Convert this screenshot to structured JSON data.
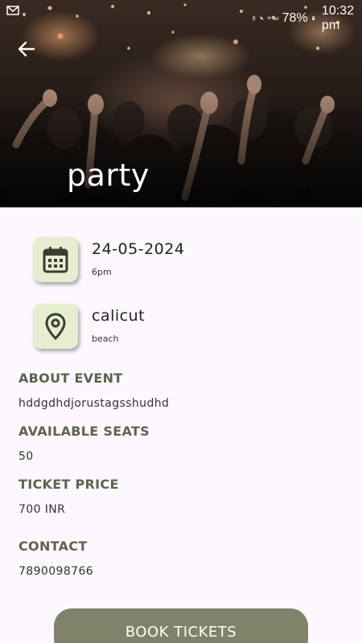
{
  "status_bar": {
    "battery_percent": "78%",
    "time": "10:32 pm"
  },
  "event": {
    "title": "party",
    "date": "24-05-2024",
    "time": "6pm",
    "location": "calicut",
    "venue": "beach"
  },
  "sections": {
    "about_heading": "ABOUT EVENT",
    "about_value": "hddgdhdjorustagsshudhd",
    "seats_heading": "AVAILABLE SEATS",
    "seats_value": "50",
    "price_heading": "TICKET PRICE",
    "price_value": "700 INR",
    "contact_heading": "CONTACT",
    "contact_value": "7890098766"
  },
  "book_button_label": "BOOK TICKETS",
  "colors": {
    "accent": "#7f836a",
    "icon_tile": "#e6eed0",
    "heading": "#5d6350",
    "background": "#fdf8fd"
  },
  "icons": [
    "mail-icon",
    "battery-saver-icon",
    "mute-icon",
    "wifi-icon",
    "signal-icon",
    "battery-icon",
    "back-arrow-icon",
    "calendar-icon",
    "location-pin-icon"
  ]
}
